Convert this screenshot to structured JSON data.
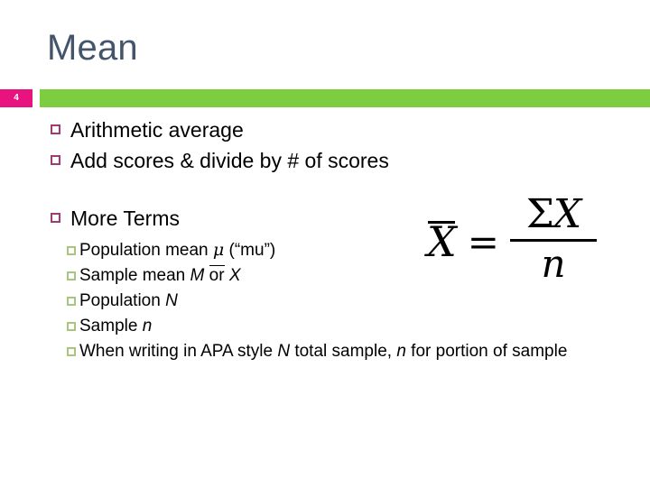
{
  "slide": {
    "title": "Mean",
    "number": "4",
    "accent_green": "#7dcd40",
    "accent_pink": "#e8137f",
    "title_color": "#44546a",
    "bullet_l1_color": "#a13a72",
    "bullet_l2_color": "#a8c47e"
  },
  "bullets": [
    {
      "text": "Arithmetic average"
    },
    {
      "text": "Add scores & divide by # of scores"
    },
    {
      "text": "More Terms"
    }
  ],
  "sub_bullets": [
    {
      "prefix": "Population mean ",
      "symbol": "μ",
      "suffix": " (“mu”)"
    },
    {
      "prefix": "Sample mean ",
      "italic_1": "M",
      "mid": "or",
      "italic_2": "X"
    },
    {
      "prefix": "Population ",
      "italic_1": "N"
    },
    {
      "prefix": "Sample ",
      "italic_1": "n"
    },
    {
      "prefix": "When writing in APA style ",
      "italic_1": "N",
      "mid2": " total sample, ",
      "italic_2": "n",
      "suffix2": " for portion of sample"
    }
  ],
  "formula": {
    "alt": "X-bar equals sigma X over n",
    "lhs": "X",
    "equals": "=",
    "numerator_sigma": "Σ",
    "numerator_var": "X",
    "denominator": "n"
  }
}
